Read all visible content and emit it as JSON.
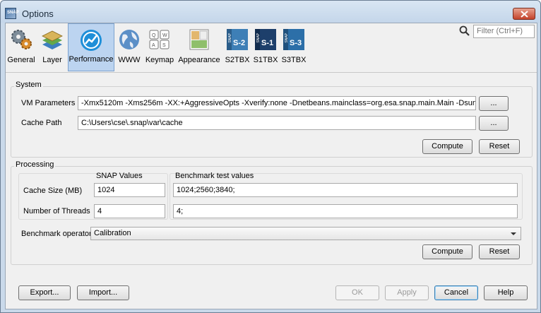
{
  "window": {
    "title": "Options"
  },
  "categories": [
    {
      "label": "General",
      "icon": "gears-icon"
    },
    {
      "label": "Layer",
      "icon": "layers-icon"
    },
    {
      "label": "Performance",
      "icon": "performance-gauge-icon",
      "selected": true
    },
    {
      "label": "WWW",
      "icon": "globe-icon"
    },
    {
      "label": "Keymap",
      "icon": "keyboard-icon"
    },
    {
      "label": "Appearance",
      "icon": "appearance-icon"
    },
    {
      "label": "S2TBX",
      "icon": "s2-toolbox-icon",
      "badge": "S-2"
    },
    {
      "label": "S1TBX",
      "icon": "s1-toolbox-icon",
      "badge": "S-1"
    },
    {
      "label": "S3TBX",
      "icon": "s3-toolbox-icon",
      "badge": "S-3"
    }
  ],
  "icon_text": {
    "snap": "SNAP"
  },
  "filter": {
    "placeholder": "Filter (Ctrl+F)"
  },
  "system": {
    "title": "System",
    "vm_label": "VM Parameters",
    "vm_value": "-Xmx5120m  -Xms256m -XX:+AggressiveOpts -Xverify:none -Dnetbeans.mainclass=org.esa.snap.main.Main -Dsun.java",
    "cache_label": "Cache Path",
    "cache_value": "C:\\Users\\cse\\.snap\\var\\cache",
    "browse_label": "...",
    "compute_label": "Compute",
    "reset_label": "Reset"
  },
  "processing": {
    "title": "Processing",
    "snap_values_header": "SNAP Values",
    "benchmark_header": "Benchmark test values",
    "cache_size_label": "Cache Size (MB)",
    "cache_size_value": "1024",
    "cache_size_bench": "1024;2560;3840;",
    "threads_label": "Number of Threads",
    "threads_value": "4",
    "threads_bench": "4;",
    "operator_label": "Benchmark operator",
    "operator_value": "Calibration",
    "compute_label": "Compute",
    "reset_label": "Reset"
  },
  "footer": {
    "export_label": "Export...",
    "import_label": "Import...",
    "ok_label": "OK",
    "apply_label": "Apply",
    "cancel_label": "Cancel",
    "help_label": "Help"
  },
  "colors": {
    "accent": "#1e8fd8",
    "selected_bg": "#bcd4f0"
  }
}
